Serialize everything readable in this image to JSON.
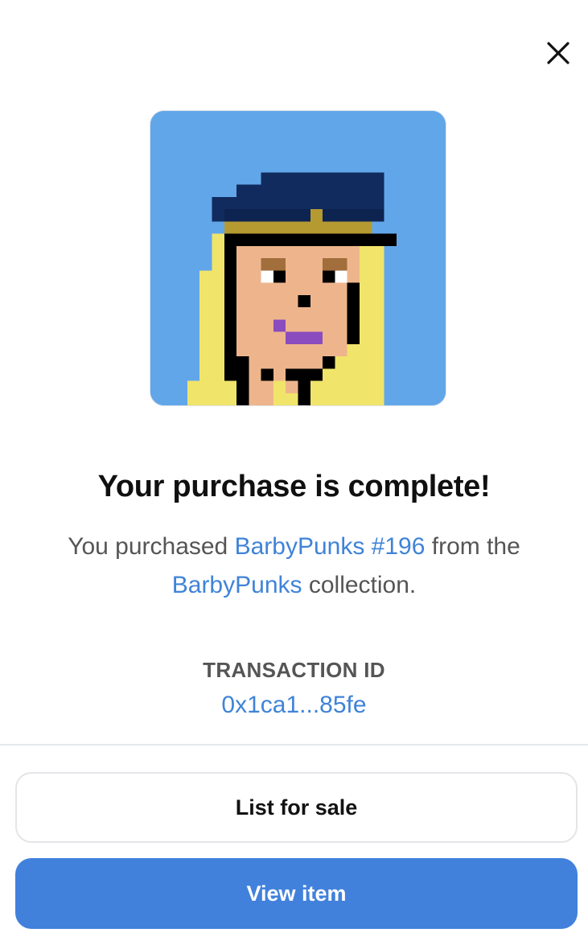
{
  "modal": {
    "close_icon": "close-icon",
    "title": "Your purchase is complete!",
    "description": {
      "prefix": "You purchased",
      "item_link": "BarbyPunks #196",
      "middle": "from the",
      "collection_link": "BarbyPunks",
      "suffix": "collection."
    },
    "transaction": {
      "label": "TRANSACTION ID",
      "value": "0x1ca1...85fe"
    },
    "buttons": {
      "list_for_sale": "List for sale",
      "view_item": "View item"
    },
    "colors": {
      "link": "#3f83d8",
      "primary_button": "#4181dc",
      "nft_background": "#62a6ea"
    }
  }
}
